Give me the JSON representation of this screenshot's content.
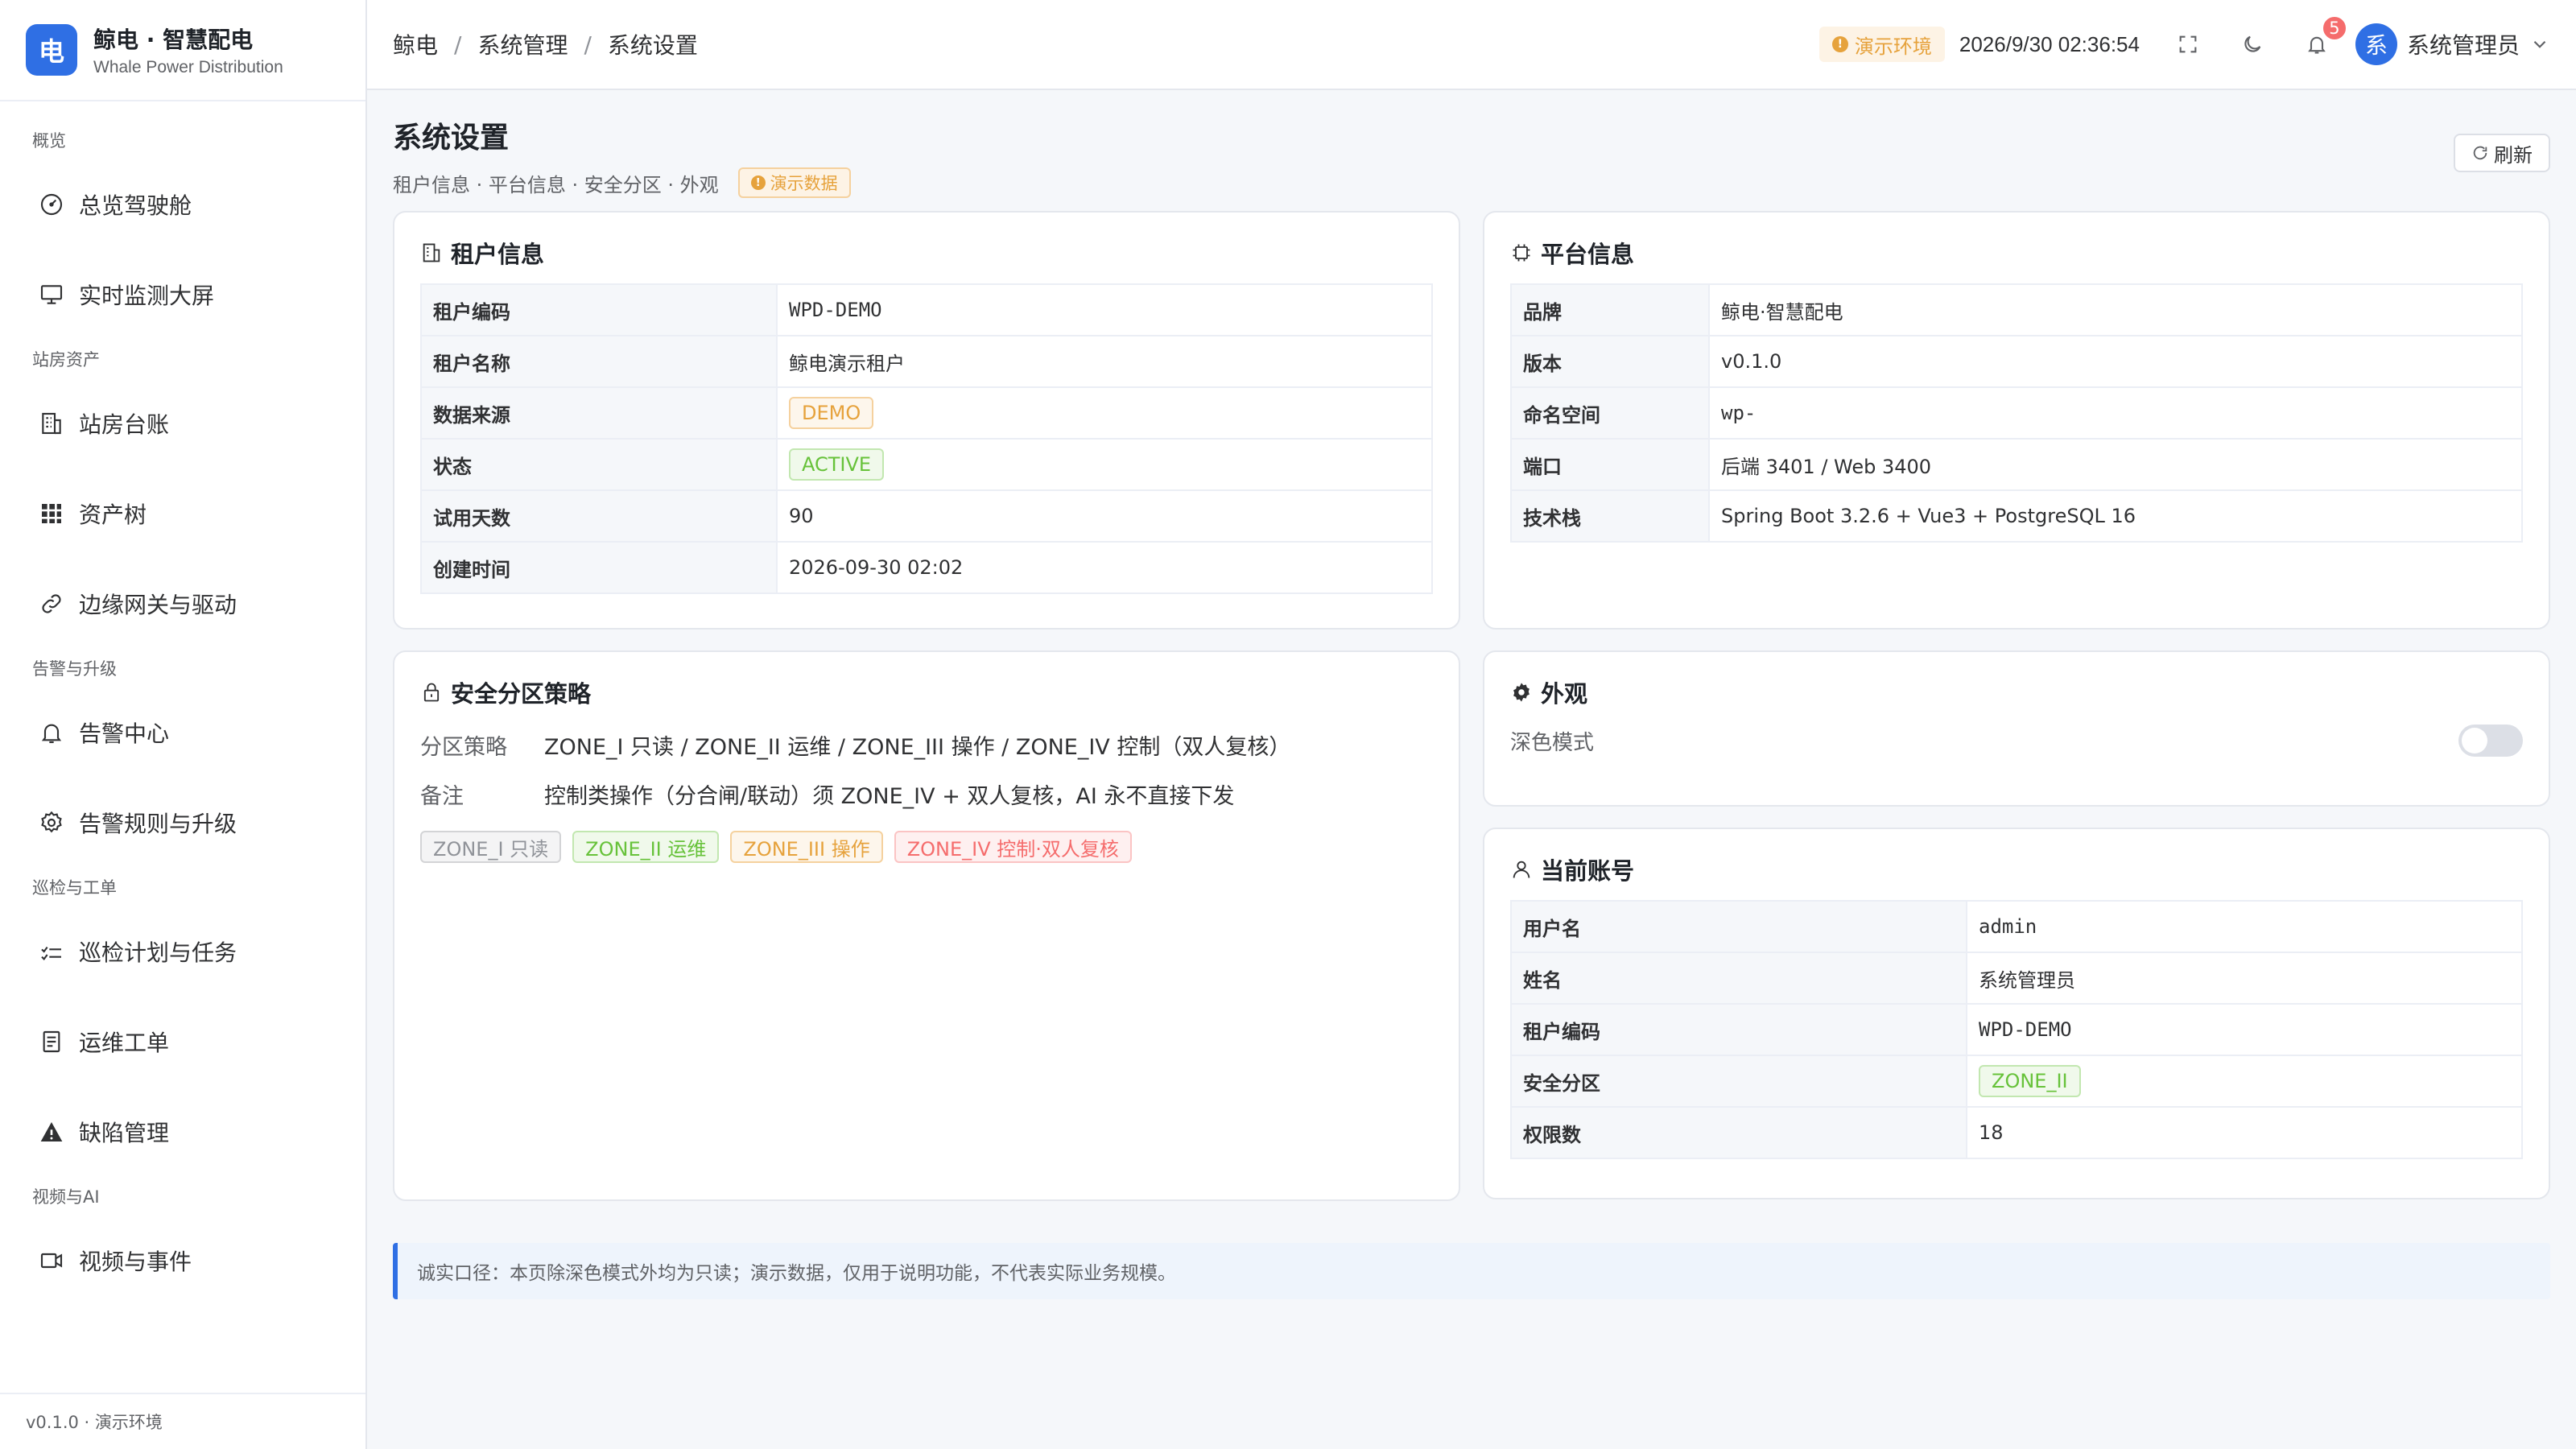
{
  "brand": {
    "logo_char": "电",
    "name": "鲸电 · 智慧配电",
    "subtitle": "Whale Power Distribution"
  },
  "sidebar": {
    "groups": [
      {
        "label": "概览",
        "items": [
          {
            "label": "总览驾驶舱",
            "icon": "gauge-icon"
          },
          {
            "label": "实时监测大屏",
            "icon": "monitor-icon"
          }
        ]
      },
      {
        "label": "站房资产",
        "items": [
          {
            "label": "站房台账",
            "icon": "building-icon"
          },
          {
            "label": "资产树",
            "icon": "grid-icon"
          },
          {
            "label": "边缘网关与驱动",
            "icon": "link-icon"
          }
        ]
      },
      {
        "label": "告警与升级",
        "items": [
          {
            "label": "告警中心",
            "icon": "bell-icon"
          },
          {
            "label": "告警规则与升级",
            "icon": "gear-icon"
          }
        ]
      },
      {
        "label": "巡检与工单",
        "items": [
          {
            "label": "巡检计划与任务",
            "icon": "checklist-icon"
          },
          {
            "label": "运维工单",
            "icon": "document-icon"
          },
          {
            "label": "缺陷管理",
            "icon": "warning-icon"
          }
        ]
      },
      {
        "label": "视频与AI",
        "items": [
          {
            "label": "视频与事件",
            "icon": "camera-icon"
          }
        ]
      }
    ],
    "footer": "v0.1.0 · 演示环境"
  },
  "topbar": {
    "breadcrumb": [
      "鲸电",
      "系统管理",
      "系统设置"
    ],
    "env_label": "演示环境",
    "datetime": "2026/9/30 02:36:54",
    "notification_count": "5",
    "avatar_char": "系",
    "user_name": "系统管理员"
  },
  "page": {
    "title": "系统设置",
    "subtitle": "租户信息 · 平台信息 · 安全分区 · 外观",
    "demo_tag": "演示数据",
    "refresh_label": "刷新"
  },
  "tenant": {
    "title": "租户信息",
    "rows": [
      {
        "key": "租户编码",
        "value": "WPD-DEMO"
      },
      {
        "key": "租户名称",
        "value": "鲸电演示租户"
      },
      {
        "key": "数据来源",
        "value": "DEMO"
      },
      {
        "key": "状态",
        "value": "ACTIVE"
      },
      {
        "key": "试用天数",
        "value": "90"
      },
      {
        "key": "创建时间",
        "value": "2026-09-30 02:02"
      }
    ]
  },
  "platform": {
    "title": "平台信息",
    "rows": [
      {
        "key": "品牌",
        "value": "鲸电·智慧配电"
      },
      {
        "key": "版本",
        "value": "v0.1.0"
      },
      {
        "key": "命名空间",
        "value": "wp-"
      },
      {
        "key": "端口",
        "value": "后端 3401 / Web 3400"
      },
      {
        "key": "技术栈",
        "value": "Spring Boot 3.2.6 + Vue3 + PostgreSQL 16"
      }
    ]
  },
  "security": {
    "title": "安全分区策略",
    "policy_key": "分区策略",
    "policy_value": "ZONE_I 只读 / ZONE_II 运维 / ZONE_III 操作 / ZONE_IV 控制（双人复核）",
    "note_key": "备注",
    "note_value": "控制类操作（分合闸/联动）须 ZONE_IV + 双人复核，AI 永不直接下发",
    "zones": [
      "ZONE_I 只读",
      "ZONE_II 运维",
      "ZONE_III 操作",
      "ZONE_IV 控制·双人复核"
    ]
  },
  "appearance": {
    "title": "外观",
    "dark_mode_label": "深色模式",
    "dark_mode_on": false
  },
  "account": {
    "title": "当前账号",
    "rows": [
      {
        "key": "用户名",
        "value": "admin"
      },
      {
        "key": "姓名",
        "value": "系统管理员"
      },
      {
        "key": "租户编码",
        "value": "WPD-DEMO"
      },
      {
        "key": "安全分区",
        "value": "ZONE_II"
      },
      {
        "key": "权限数",
        "value": "18"
      }
    ]
  },
  "notice": "诚实口径：本页除深色模式外均为只读；演示数据，仅用于说明功能，不代表实际业务规模。",
  "colors": {
    "primary": "#2f6fe4",
    "warning": "#e6a23c",
    "success": "#67c23a",
    "danger": "#f56c6c",
    "info": "#909399"
  }
}
